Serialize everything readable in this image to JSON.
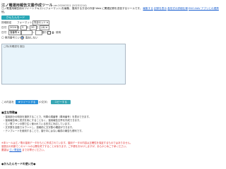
{
  "header": {
    "title": "江ノ電運用報告文書作成ツール",
    "version": "ver.20240311 (20231214)"
  },
  "intro": {
    "line1": "江ノ電運用報告用のツイートテキスト(フォーマット)を編集、運用する方法の外部 Web に関連記録を送信するツールです。",
    "link1": "編集する",
    "link2": "記録を表示",
    "link3": "各形式の詳細仕様",
    "link4": "ENO-NAV アプリとの連携",
    "line2": "他。"
  },
  "mode_button": "かんたんモード",
  "form": {
    "tab_label": "詳細設定",
    "format_label": "フォーマット",
    "format_value": "完全セット",
    "format_arrow": "▼",
    "row2": {
      "date_label": "日付",
      "year": "2024",
      "year_unit": "年",
      "month": "3",
      "month_unit": "月",
      "day": "20",
      "day_unit": "日",
      "weekday": "(水)",
      "weekday_arrow": "▼"
    },
    "row3": {
      "time_label": "日付",
      "kind_value": "運番等",
      "kind_arrow": "▼",
      "field_value": "",
      "sep": "～",
      "unit_label": "運行",
      "num_value": "",
      "unit_label2": "番",
      "checkbox_label": "使用"
    },
    "row4": {
      "option1": "〇",
      "option1_label": "車両番号とい",
      "option2_label": "追加しない"
    },
    "textarea_placeholder": "□特/未確認を追加"
  },
  "counter": {
    "label": "この内容を",
    "tweet_button": "★ツイートする",
    "count": "(0文字)",
    "copy_button": "コピーする"
  },
  "guide": {
    "title": "■主な特徴■",
    "items": [
      "・運用部分の時刻を選択することで、列車の順番等（車両番号）を表示できます。",
      "・運用報告時に書式を気にすることなく、運用報告文章を作成できます。",
      "・江ノ電ファンの間で広く使われている形式に対応しています。",
      "・文字数を自動でカウントし、投稿前に文字数の確認ができます。",
      "・テンプレートを使用することで、運行中にはない編成の報告も便利です。"
    ]
  },
  "notice": {
    "line1": "※本ツールは江ノ電の運用データをもとに作成されています。運用データの内容は正確性を保証するものではありません。",
    "line2": "運営元の判断でこのツールの公開を終了することがあります。ご不便をおかけしますが、あらかじめご了承ください。",
    "line3_prefix": "要望は",
    "line3_link": "江ノ電運用",
    "line3_suffix": "まで",
    "line3_rest": "お寄せください。"
  },
  "footer": {
    "title": "●かんたんモードの使い方●"
  }
}
